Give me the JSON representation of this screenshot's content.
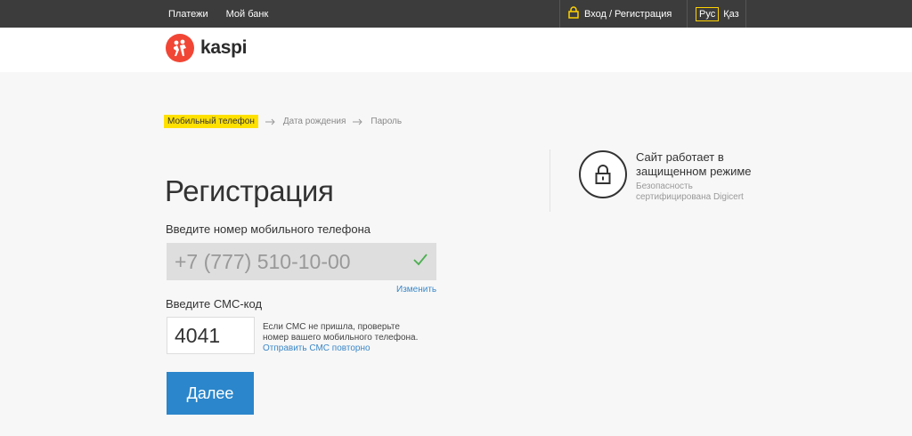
{
  "topbar": {
    "nav": [
      "Платежи",
      "Мой банк"
    ],
    "login_label": "Вход / Регистрация",
    "lang_active": "Рус",
    "lang_other": "Қаз"
  },
  "header": {
    "logo_text": "kaspi"
  },
  "steps": [
    "Мобильный телефон",
    "Дата рождения",
    "Пароль"
  ],
  "form": {
    "title": "Регистрация",
    "phone_label": "Введите номер мобильного телефона",
    "phone_value": "+7 (777) 510-10-00",
    "change_link": "Изменить",
    "sms_label": "Введите СМС-код",
    "sms_value": "4041",
    "sms_note": "Если СМС не пришла, проверьте номер вашего мобильного телефона.",
    "resend_link": "Отправить СМС повторно",
    "next_button": "Далее"
  },
  "security": {
    "title": "Сайт работает в защищенном режиме",
    "note": "Безопасность сертифицирована Digicert"
  },
  "colors": {
    "accent": "#2b86cb",
    "brand": "#f14635",
    "highlight": "#ffe100",
    "topbar": "#3c3c3c"
  }
}
